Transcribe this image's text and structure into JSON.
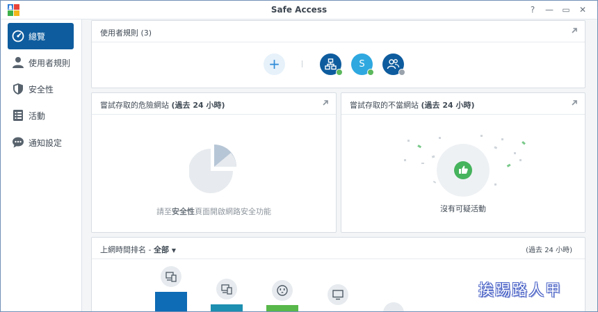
{
  "window": {
    "title": "Safe Access"
  },
  "title_controls": {
    "help": "?",
    "minimize": "—",
    "maximize": "▭",
    "close": "✕"
  },
  "sidebar": {
    "items": [
      {
        "label": "總覽",
        "icon": "gauge-icon",
        "active": true
      },
      {
        "label": "使用者規則",
        "icon": "user-icon",
        "active": false
      },
      {
        "label": "安全性",
        "icon": "shield-icon",
        "active": false
      },
      {
        "label": "活動",
        "icon": "activity-list-icon",
        "active": false
      },
      {
        "label": "通知設定",
        "icon": "chat-bubble-icon",
        "active": false
      }
    ]
  },
  "user_rules_card": {
    "title": "使用者規則 (3)",
    "add_label": "+",
    "profiles": [
      {
        "icon": "network-icon",
        "status": "online"
      },
      {
        "label": "S",
        "status": "online"
      },
      {
        "icon": "user-group-icon",
        "status": "offline"
      }
    ]
  },
  "dangerous_sites_card": {
    "title": "嘗試存取的危險網站",
    "period": "(過去 24 小時)",
    "empty_prefix": "請至",
    "empty_link": "安全性",
    "empty_suffix": "頁面開啟網路安全功能"
  },
  "inappropriate_sites_card": {
    "title": "嘗試存取的不當網站",
    "period": "(過去 24 小時)",
    "empty_text": "沒有可疑活動"
  },
  "online_ranking_card": {
    "title": "上網時間排名 -",
    "filter": "全部",
    "period": "(過去 24 小時)",
    "devices": [
      {
        "icon": "devices-icon"
      },
      {
        "icon": "devices-icon"
      },
      {
        "icon": "power-outlet-icon"
      },
      {
        "icon": "monitor-icon"
      },
      {
        "icon": "generic-device-icon"
      }
    ]
  },
  "watermark": "挨踢路人甲",
  "colors": {
    "accent": "#0e5c9e",
    "online": "#5cb85c",
    "offline": "#9aa3ac",
    "thumb": "#46b35d"
  }
}
